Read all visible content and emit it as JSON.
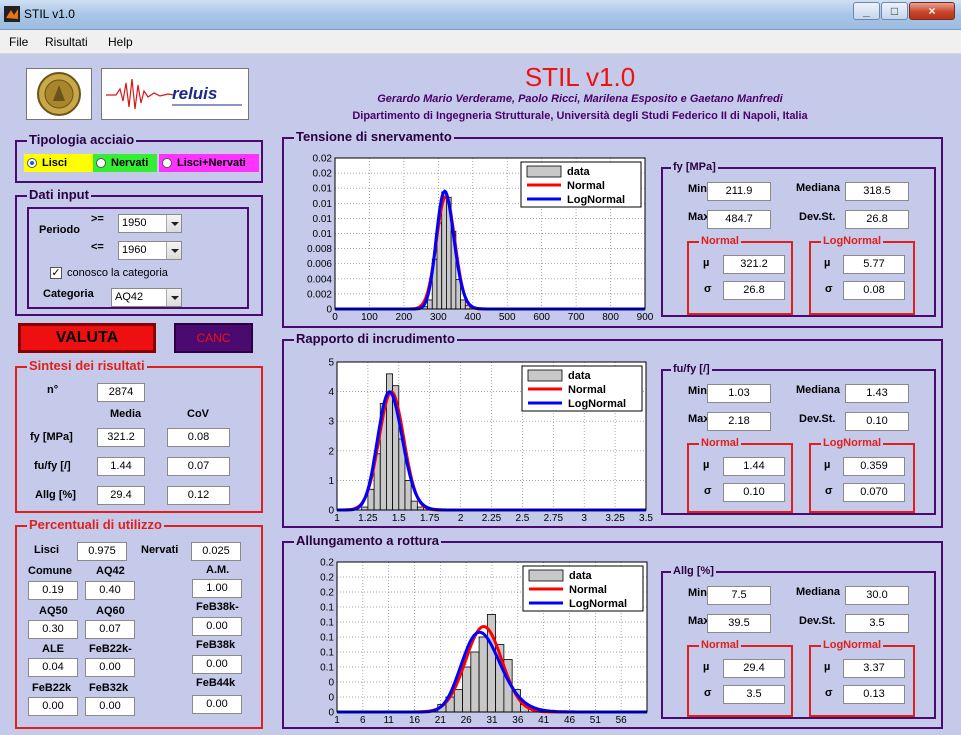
{
  "window": {
    "title": "STIL v1.0",
    "min": "_",
    "max": "□",
    "close": "×"
  },
  "menu": [
    "File",
    "Risultati",
    "Help"
  ],
  "header": {
    "title": "STIL v1.0",
    "authors": "Gerardo Mario Verderame, Paolo Ricci, Marilena Esposito e Gaetano Manfredi",
    "department": "Dipartimento di Ingegneria Strutturale, Università degli Studi Federico II di Napoli, Italia",
    "logo_text": "reluis"
  },
  "tipologia": {
    "title": "Tipologia acciaio",
    "options": [
      {
        "label": "Lisci",
        "selected": true,
        "color": "#ffff00"
      },
      {
        "label": "Nervati",
        "selected": false,
        "color": "#33ee33"
      },
      {
        "label": "Lisci+Nervati",
        "selected": false,
        "color": "#ff33ff"
      }
    ]
  },
  "dati_input": {
    "title": "Dati input",
    "periodo_label": "Periodo",
    "ge_label": ">=",
    "le_label": "<=",
    "from_value": "1950",
    "to_value": "1960",
    "conosco_label": "conosco la categoria",
    "conosco_checked": true,
    "check_mark": "✓",
    "categoria_label": "Categoria",
    "categoria_value": "AQ42"
  },
  "buttons": {
    "valuta": "VALUTA",
    "canc": "CANC"
  },
  "sintesi": {
    "title": "Sintesi dei risultati",
    "n_label": "n°",
    "n_value": "2874",
    "media_label": "Media",
    "cov_label": "CoV",
    "rows": [
      {
        "label": "fy [MPa]",
        "media": "321.2",
        "cov": "0.08"
      },
      {
        "label": "fu/fy [/]",
        "media": "1.44",
        "cov": "0.07"
      },
      {
        "label": "Allg [%]",
        "media": "29.4",
        "cov": "0.12"
      }
    ]
  },
  "percentuali": {
    "title": "Percentuali di utilizzo",
    "lisci_label": "Lisci",
    "lisci_value": "0.975",
    "nervati_label": "Nervati",
    "nervati_value": "0.025",
    "items": [
      {
        "label": "Comune",
        "value": "0.19"
      },
      {
        "label": "AQ42",
        "value": "0.40"
      },
      {
        "label": "A.M.",
        "value": "1.00"
      },
      {
        "label": "AQ50",
        "value": "0.30"
      },
      {
        "label": "AQ60",
        "value": "0.07"
      },
      {
        "label": "FeB38k-",
        "value": "0.00"
      },
      {
        "label": "ALE",
        "value": "0.04"
      },
      {
        "label": "FeB22k-",
        "value": "0.00"
      },
      {
        "label": "FeB38k",
        "value": "0.00"
      },
      {
        "label": "FeB22k",
        "value": "0.00"
      },
      {
        "label": "FeB32k",
        "value": "0.00"
      },
      {
        "label": "FeB44k",
        "value": "0.00"
      }
    ]
  },
  "legend": {
    "data": "data",
    "normal": "Normal",
    "lognormal": "LogNormal"
  },
  "colors": {
    "bars": "#c8c8c8",
    "normal": "#ff0000",
    "lognormal": "#0000ff",
    "panel_border": "#4a0a70",
    "red_border": "#e0201a"
  },
  "stats": [
    {
      "title": "fy [MPa]",
      "min_label": "Min",
      "min": "211.9",
      "mediana_label": "Mediana",
      "mediana": "318.5",
      "max_label": "Max",
      "max": "484.7",
      "dev_label": "Dev.St.",
      "dev": "26.8",
      "normal_title": "Normal",
      "mu_label": "µ",
      "sigma_label": "σ",
      "n_mu": "321.2",
      "n_sigma": "26.8",
      "log_title": "LogNormal",
      "l_mu": "5.77",
      "l_sigma": "0.08"
    },
    {
      "title": "fu/fy [/]",
      "min_label": "Min",
      "min": "1.03",
      "mediana_label": "Mediana",
      "mediana": "1.43",
      "max_label": "Max",
      "max": "2.18",
      "dev_label": "Dev.St.",
      "dev": "0.10",
      "normal_title": "Normal",
      "mu_label": "µ",
      "sigma_label": "σ",
      "n_mu": "1.44",
      "n_sigma": "0.10",
      "log_title": "LogNormal",
      "l_mu": "0.359",
      "l_sigma": "0.070"
    },
    {
      "title": "Allg [%]",
      "min_label": "Min",
      "min": "7.5",
      "mediana_label": "Mediana",
      "mediana": "30.0",
      "max_label": "Max",
      "max": "39.5",
      "dev_label": "Dev.St.",
      "dev": "3.5",
      "normal_title": "Normal",
      "mu_label": "µ",
      "sigma_label": "σ",
      "n_mu": "29.4",
      "n_sigma": "3.5",
      "log_title": "LogNormal",
      "l_mu": "3.37",
      "l_sigma": "0.13"
    }
  ],
  "chart_data": [
    {
      "type": "bar",
      "title": "Tensione di snervamento",
      "xlim": [
        0,
        900
      ],
      "ylim": [
        0,
        0.02
      ],
      "x_ticks": [
        0,
        100,
        200,
        300,
        400,
        500,
        600,
        700,
        800,
        900
      ],
      "y_tick_values": [
        0,
        0.002,
        0.004,
        0.006,
        0.008,
        0.01,
        0.012,
        0.014,
        0.016,
        0.018,
        0.02
      ],
      "y_tick_labels": [
        "0",
        "0.002",
        "0.004",
        "0.006",
        "0.008",
        "0.01",
        "0.01",
        "0.01",
        "0.01",
        "0.02",
        "0.02"
      ],
      "bin_width": 13.7,
      "bins": [
        {
          "x": 255,
          "v": 0.0003
        },
        {
          "x": 268.7,
          "v": 0.0012
        },
        {
          "x": 282.4,
          "v": 0.0066
        },
        {
          "x": 296.1,
          "v": 0.0114
        },
        {
          "x": 309.8,
          "v": 0.0155
        },
        {
          "x": 323.5,
          "v": 0.0148
        },
        {
          "x": 337.2,
          "v": 0.0103
        },
        {
          "x": 350.9,
          "v": 0.0039
        },
        {
          "x": 364.6,
          "v": 0.0012
        },
        {
          "x": 378.3,
          "v": 0.0005
        }
      ],
      "series": [
        {
          "name": "Normal",
          "dist": "normal",
          "mu": 321.2,
          "sigma": 26.8
        },
        {
          "name": "LogNormal",
          "dist": "lognormal",
          "mu": 5.77,
          "sigma": 0.08
        }
      ]
    },
    {
      "type": "bar",
      "title": "Rapporto di incrudimento",
      "xlim": [
        1,
        3.5
      ],
      "ylim": [
        0,
        5
      ],
      "x_ticks": [
        1,
        1.25,
        1.5,
        1.75,
        2,
        2.25,
        2.5,
        2.75,
        3,
        3.25,
        3.5
      ],
      "x_tick_labels": [
        "1",
        "1.25",
        "1.5",
        "1.75",
        "2",
        "2.25",
        "2.5",
        "2.75",
        "3",
        "3.25",
        "3.5"
      ],
      "y_tick_values": [
        0,
        1,
        2,
        3,
        4,
        5
      ],
      "y_tick_labels": [
        "0",
        "1",
        "2",
        "3",
        "4",
        "5"
      ],
      "bin_width": 0.05,
      "bins": [
        {
          "x": 1.2,
          "v": 0.1
        },
        {
          "x": 1.25,
          "v": 0.7
        },
        {
          "x": 1.3,
          "v": 1.9
        },
        {
          "x": 1.35,
          "v": 3.6
        },
        {
          "x": 1.4,
          "v": 4.6
        },
        {
          "x": 1.45,
          "v": 4.2
        },
        {
          "x": 1.5,
          "v": 2.4
        },
        {
          "x": 1.55,
          "v": 1.0
        },
        {
          "x": 1.6,
          "v": 0.3
        },
        {
          "x": 1.65,
          "v": 0.1
        }
      ],
      "series": [
        {
          "name": "Normal",
          "dist": "normal",
          "mu": 1.44,
          "sigma": 0.1
        },
        {
          "name": "LogNormal",
          "dist": "lognormal",
          "mu": 0.359,
          "sigma": 0.07
        }
      ]
    },
    {
      "type": "bar",
      "title": "Allungamento a rottura",
      "xlim": [
        1,
        61
      ],
      "ylim": [
        0,
        0.2
      ],
      "x_ticks": [
        1,
        6,
        11,
        16,
        21,
        26,
        31,
        36,
        41,
        46,
        51,
        56
      ],
      "y_tick_values": [
        0,
        0.02,
        0.04,
        0.06,
        0.08,
        0.1,
        0.12,
        0.14,
        0.16,
        0.18,
        0.2
      ],
      "y_tick_labels": [
        "0",
        "0",
        "0",
        "0.1",
        "0.1",
        "0.1",
        "0.1",
        "0.1",
        "0.2",
        "0.2",
        "0.2"
      ],
      "bin_width": 1.6,
      "bins": [
        {
          "x": 20.5,
          "v": 0.01
        },
        {
          "x": 22.1,
          "v": 0.02
        },
        {
          "x": 23.7,
          "v": 0.03
        },
        {
          "x": 25.3,
          "v": 0.06
        },
        {
          "x": 26.9,
          "v": 0.08
        },
        {
          "x": 28.5,
          "v": 0.1
        },
        {
          "x": 30.1,
          "v": 0.13
        },
        {
          "x": 31.7,
          "v": 0.09
        },
        {
          "x": 33.3,
          "v": 0.07
        },
        {
          "x": 34.9,
          "v": 0.03
        },
        {
          "x": 36.5,
          "v": 0.01
        }
      ],
      "series": [
        {
          "name": "Normal",
          "dist": "normal",
          "mu": 29.4,
          "sigma": 3.5
        },
        {
          "name": "LogNormal",
          "dist": "lognormal",
          "mu": 3.37,
          "sigma": 0.13
        }
      ]
    }
  ]
}
